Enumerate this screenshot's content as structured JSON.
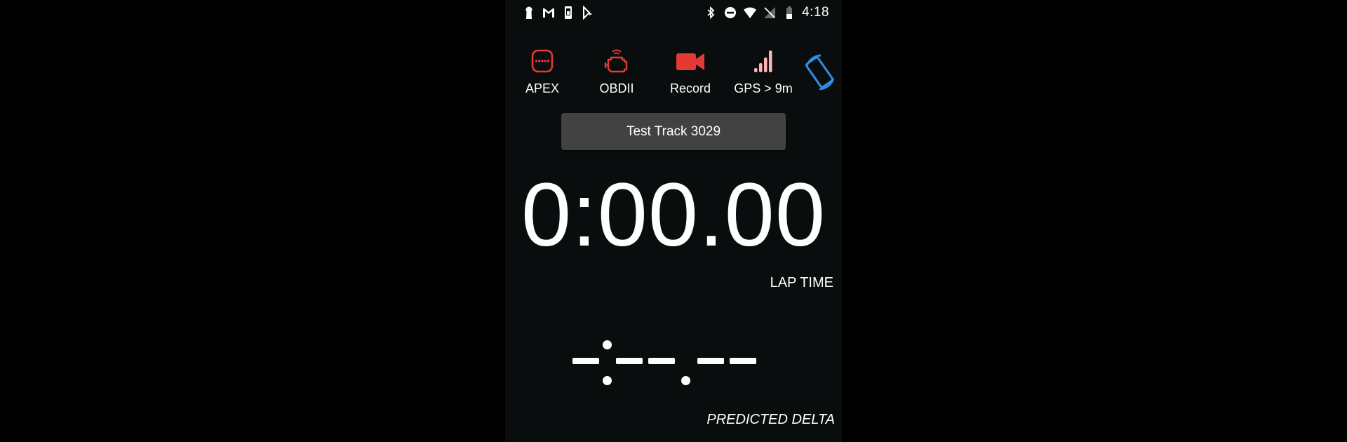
{
  "status_bar": {
    "time": "4:18",
    "left_icons": [
      "keyhole-icon",
      "gmail-icon",
      "phone-device-icon",
      "play-store-icon"
    ],
    "right_icons": [
      "bluetooth-icon",
      "do-not-disturb-icon",
      "wifi-icon",
      "no-signal-icon",
      "battery-icon"
    ]
  },
  "toolbar": {
    "apex": {
      "label": "APEX",
      "icon": "apex-dots-icon",
      "color": "#e53935"
    },
    "obd": {
      "label": "OBDII",
      "icon": "engine-icon",
      "color": "#e53935"
    },
    "record": {
      "label": "Record",
      "icon": "video-camera-icon",
      "color": "#e53935"
    },
    "gps": {
      "label": "GPS > 9m",
      "icon": "signal-bars-icon",
      "color": "#ffb3b3"
    },
    "rotate": {
      "icon": "screen-rotate-icon",
      "color": "#2f8fe0"
    }
  },
  "track": {
    "label": "Test Track 3029"
  },
  "lap": {
    "time": "0:00.00",
    "label": "LAP TIME"
  },
  "delta": {
    "label": "PREDICTED DELTA"
  }
}
